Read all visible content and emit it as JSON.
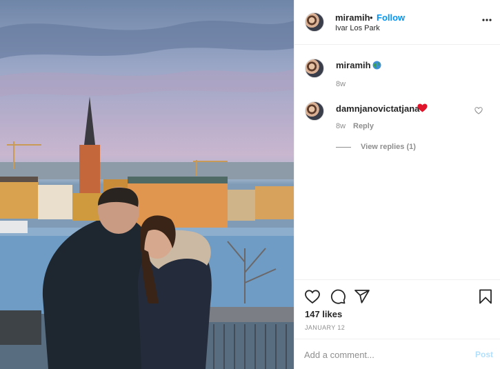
{
  "post": {
    "username": "miramih",
    "separator": "•",
    "follow_label": "Follow",
    "location": "Ivar Los Park",
    "more_icon": "more-horizontal-icon"
  },
  "comments": [
    {
      "username": "miramih",
      "emoji": "globe-icon",
      "time": "8w"
    },
    {
      "username": "damnjanovictatjana",
      "emoji": "red-heart-icon",
      "time": "8w",
      "reply_label": "Reply",
      "view_replies_label": "View replies (1)"
    }
  ],
  "actions": {
    "likes": "147 likes",
    "date": "JANUARY 12"
  },
  "add_comment": {
    "placeholder": "Add a comment...",
    "post_label": "Post"
  },
  "colors": {
    "link_blue": "#0095f6",
    "post_disabled": "#b2dffc",
    "muted": "#8e8e8e",
    "text": "#262626",
    "heart_red": "#ed4956"
  }
}
